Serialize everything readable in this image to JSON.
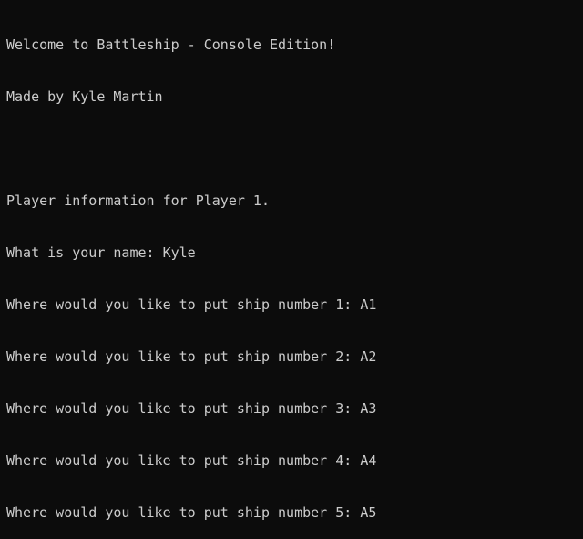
{
  "console": {
    "lines": [
      "Welcome to Battleship - Console Edition!",
      "Made by Kyle Martin",
      "",
      "Player information for Player 1.",
      "What is your name: Kyle",
      "Where would you like to put ship number 1: A1",
      "Where would you like to put ship number 2: A2",
      "Where would you like to put ship number 3: A3",
      "Where would you like to put ship number 4: A4",
      "Where would you like to put ship number 5: A5"
    ],
    "colors": {
      "background": "#0c0c0c",
      "text": "#cccccc"
    }
  }
}
